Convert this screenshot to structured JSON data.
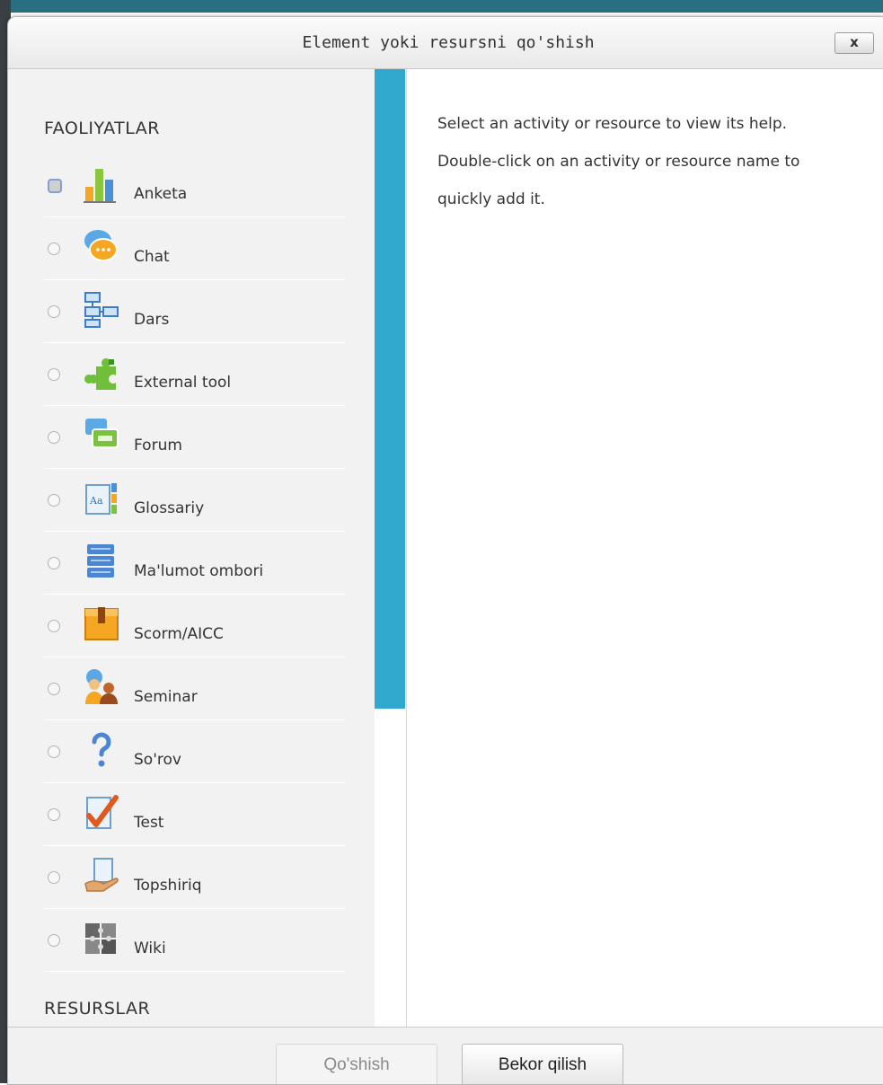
{
  "dialog": {
    "title": "Element yoki resursni qo'shish",
    "close_label": "x"
  },
  "options": {
    "section_activities": "FAOLIYATLAR",
    "section_resources": "RESURSLAR",
    "items": [
      {
        "label": "Anketa",
        "icon": "bar-chart-icon",
        "focused": true
      },
      {
        "label": "Chat",
        "icon": "chat-bubble-icon"
      },
      {
        "label": "Dars",
        "icon": "lesson-flow-icon"
      },
      {
        "label": "External tool",
        "icon": "puzzle-piece-icon"
      },
      {
        "label": "Forum",
        "icon": "forum-bubbles-icon"
      },
      {
        "label": "Glossariy",
        "icon": "glossary-book-icon"
      },
      {
        "label": "Ma'lumot ombori",
        "icon": "database-icon"
      },
      {
        "label": "Scorm/AICC",
        "icon": "package-box-icon"
      },
      {
        "label": "Seminar",
        "icon": "workshop-people-icon"
      },
      {
        "label": "So'rov",
        "icon": "question-mark-icon"
      },
      {
        "label": "Test",
        "icon": "quiz-checkmark-icon"
      },
      {
        "label": "Topshiriq",
        "icon": "assignment-hand-icon"
      },
      {
        "label": "Wiki",
        "icon": "wiki-puzzle-icon"
      }
    ]
  },
  "help": {
    "text": "Select an activity or resource to view its help. Double-click on an activity or resource name to quickly add it."
  },
  "footer": {
    "add_label": "Qo'shish",
    "cancel_label": "Bekor qilish"
  },
  "colors": {
    "scroll_accent": "#31a9cf",
    "panel_bg": "#f2f2f2"
  }
}
